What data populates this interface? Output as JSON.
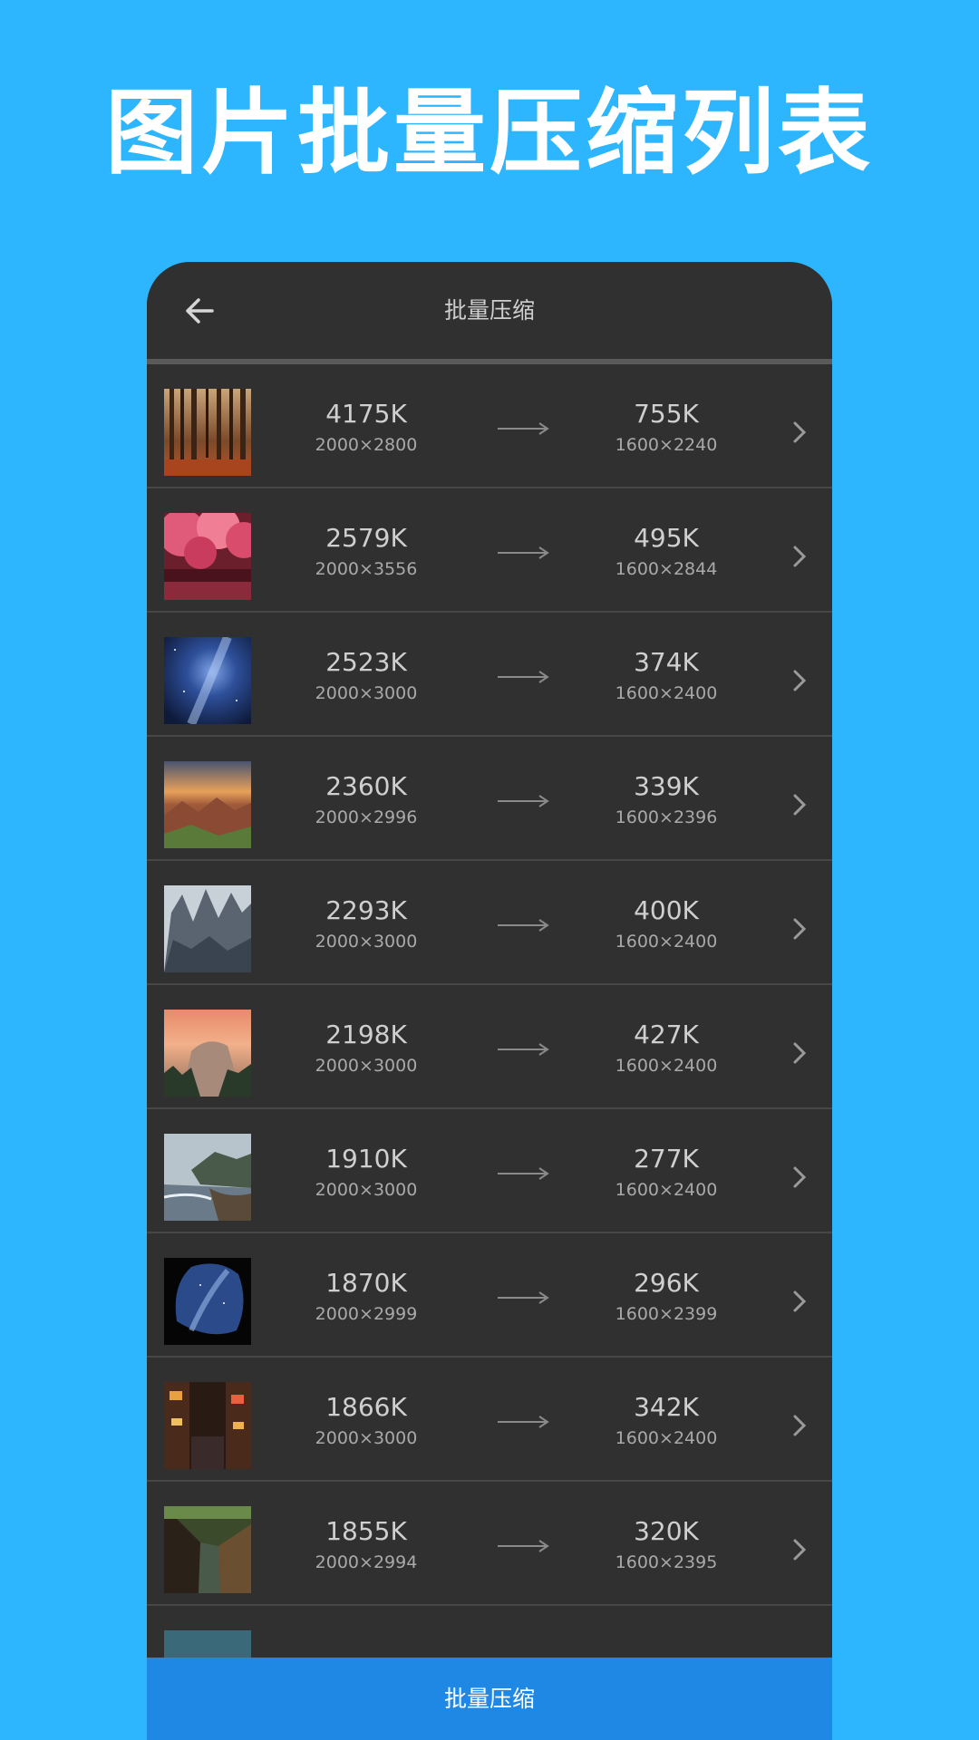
{
  "hero": {
    "title": "图片批量压缩列表"
  },
  "app_bar": {
    "title": "批量压缩",
    "back_icon": "arrow-left-icon"
  },
  "colors": {
    "background": "#2db6fd",
    "panel": "#303030",
    "button": "#1f88e5"
  },
  "rows": [
    {
      "orig_size": "4175K",
      "orig_dims": "2000×2800",
      "new_size": "755K",
      "new_dims": "1600×2240",
      "thumb": "forest"
    },
    {
      "orig_size": "2579K",
      "orig_dims": "2000×3556",
      "new_size": "495K",
      "new_dims": "1600×2844",
      "thumb": "pink-trees"
    },
    {
      "orig_size": "2523K",
      "orig_dims": "2000×3000",
      "new_size": "374K",
      "new_dims": "1600×2400",
      "thumb": "milky-way"
    },
    {
      "orig_size": "2360K",
      "orig_dims": "2000×2996",
      "new_size": "339K",
      "new_dims": "1600×2396",
      "thumb": "badlands"
    },
    {
      "orig_size": "2293K",
      "orig_dims": "2000×3000",
      "new_size": "400K",
      "new_dims": "1600×2400",
      "thumb": "rocky-peaks"
    },
    {
      "orig_size": "2198K",
      "orig_dims": "2000×3000",
      "new_size": "427K",
      "new_dims": "1600×2400",
      "thumb": "half-dome"
    },
    {
      "orig_size": "1910K",
      "orig_dims": "2000×3000",
      "new_size": "277K",
      "new_dims": "1600×2400",
      "thumb": "coastline"
    },
    {
      "orig_size": "1870K",
      "orig_dims": "2000×2999",
      "new_size": "296K",
      "new_dims": "1600×2399",
      "thumb": "cave-stars"
    },
    {
      "orig_size": "1866K",
      "orig_dims": "2000×3000",
      "new_size": "342K",
      "new_dims": "1600×2400",
      "thumb": "city-street"
    },
    {
      "orig_size": "1855K",
      "orig_dims": "2000×2994",
      "new_size": "320K",
      "new_dims": "1600×2395",
      "thumb": "canal"
    }
  ],
  "bottom_button": {
    "label": "批量压缩"
  }
}
